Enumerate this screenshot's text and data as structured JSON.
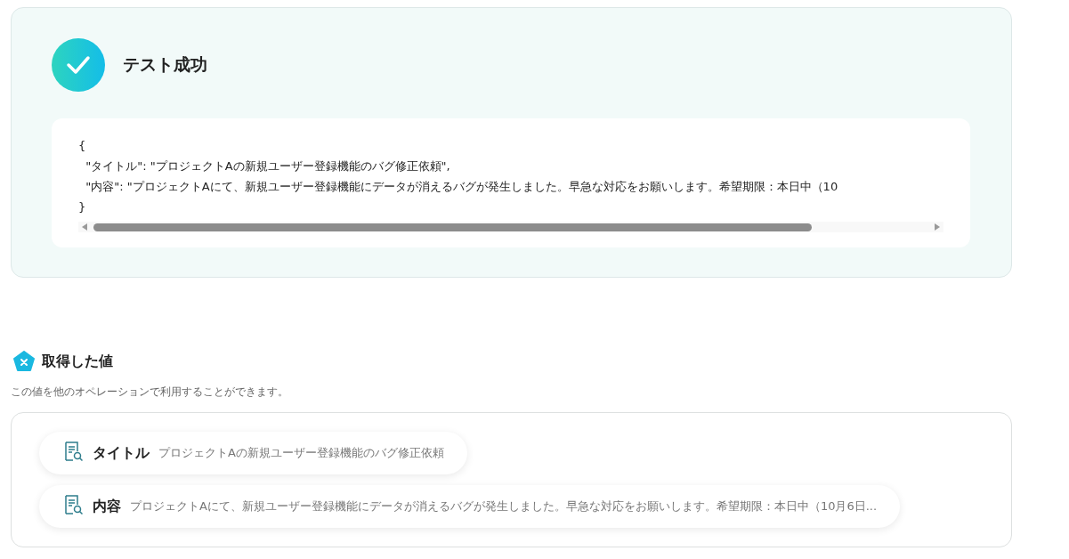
{
  "test_result": {
    "title": "テスト成功",
    "success": true,
    "code_lines": [
      "{",
      "  \"タイトル\": \"プロジェクトAの新規ユーザー登録機能のバグ修正依頼\",",
      "  \"内容\": \"プロジェクトAにて、新規ユーザー登録機能にデータが消えるバグが発生しました。早急な対応をお願いします。希望期限：本日中（10",
      "}"
    ]
  },
  "values_section": {
    "title": "取得した値",
    "description": "この値を他のオペレーションで利用することができます。",
    "items": [
      {
        "label": "タイトル",
        "value": "プロジェクトAの新規ユーザー登録機能のバグ修正依頼"
      },
      {
        "label": "内容",
        "value": "プロジェクトAにて、新規ユーザー登録機能にデータが消えるバグが発生しました。早急な対応をお願いします。希望期限：本日中（10月6日..."
      }
    ]
  }
}
